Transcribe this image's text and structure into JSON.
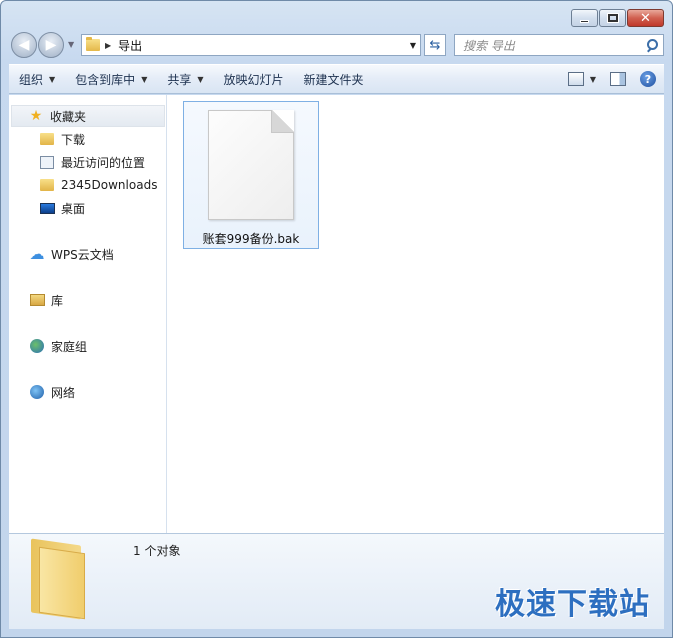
{
  "window": {
    "caption_buttons": [
      "minimize",
      "maximize",
      "close"
    ]
  },
  "nav": {
    "address_segment": "导出",
    "search_placeholder": "搜索 导出"
  },
  "toolbar": {
    "organize": "组织",
    "include_in_library": "包含到库中",
    "share": "共享",
    "slideshow": "放映幻灯片",
    "new_folder": "新建文件夹"
  },
  "sidebar": {
    "favorites": "收藏夹",
    "items": [
      {
        "label": "下载",
        "icon": "download-folder-icon"
      },
      {
        "label": "最近访问的位置",
        "icon": "recent-places-icon"
      },
      {
        "label": "2345Downloads",
        "icon": "folder-icon"
      },
      {
        "label": "桌面",
        "icon": "desktop-icon"
      }
    ],
    "wps_cloud": "WPS云文档",
    "libraries": "库",
    "homegroup": "家庭组",
    "network": "网络"
  },
  "files": [
    {
      "name": "账套999备份.bak",
      "icon": "blank-file-icon"
    }
  ],
  "details": {
    "count": "1 个对象"
  },
  "watermark": "极速下载站",
  "colors": {
    "accent": "#2d6fc0",
    "frame": "#c7d9ef",
    "selection_border": "#7fb0e4"
  }
}
